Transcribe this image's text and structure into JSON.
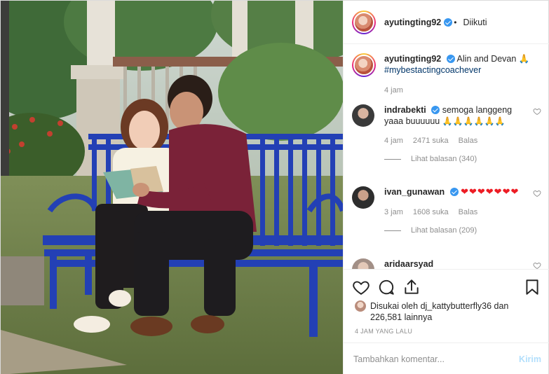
{
  "post": {
    "author": "ayutingting92",
    "follow_status": "Diikuti",
    "caption_text": "Alin and Devan",
    "caption_emoji": "🙏",
    "caption_hashtag": "#mybestactingcoachever",
    "caption_time": "4 jam",
    "liked_by_prefix": "Disukai oleh",
    "liked_by_user": "dj_kattybutterfly36",
    "liked_by_and": "dan",
    "likes_count": "226,581 lainnya",
    "time_ago": "4 JAM YANG LALU"
  },
  "comments": [
    {
      "user": "indrabekti",
      "verified": true,
      "text": "semoga langgeng yaaa buuuuuu",
      "emoji": "🙏🙏🙏🙏🙏🙏",
      "time": "4 jam",
      "likes": "2471 suka",
      "reply_label": "Balas",
      "replies_label": "Lihat balasan (340)"
    },
    {
      "user": "ivan_gunawan",
      "verified": true,
      "text": "",
      "emoji": "❤❤❤❤❤❤❤",
      "time": "3 jam",
      "likes": "1608 suka",
      "reply_label": "Balas",
      "replies_label": "Lihat balasan (209)"
    },
    {
      "user": "aridaarsyad",
      "verified": false,
      "text": ""
    }
  ],
  "add_comment": {
    "placeholder": "Tambahkan komentar...",
    "post_label": "Kirim"
  },
  "colors": {
    "verified_blue": "#3897f0",
    "text_primary": "#262626",
    "text_secondary": "#8e8e8e",
    "post_disabled": "#b2dffc"
  },
  "icons": [
    "heart-icon",
    "comment-icon",
    "share-icon",
    "bookmark-icon",
    "verified-icon"
  ]
}
